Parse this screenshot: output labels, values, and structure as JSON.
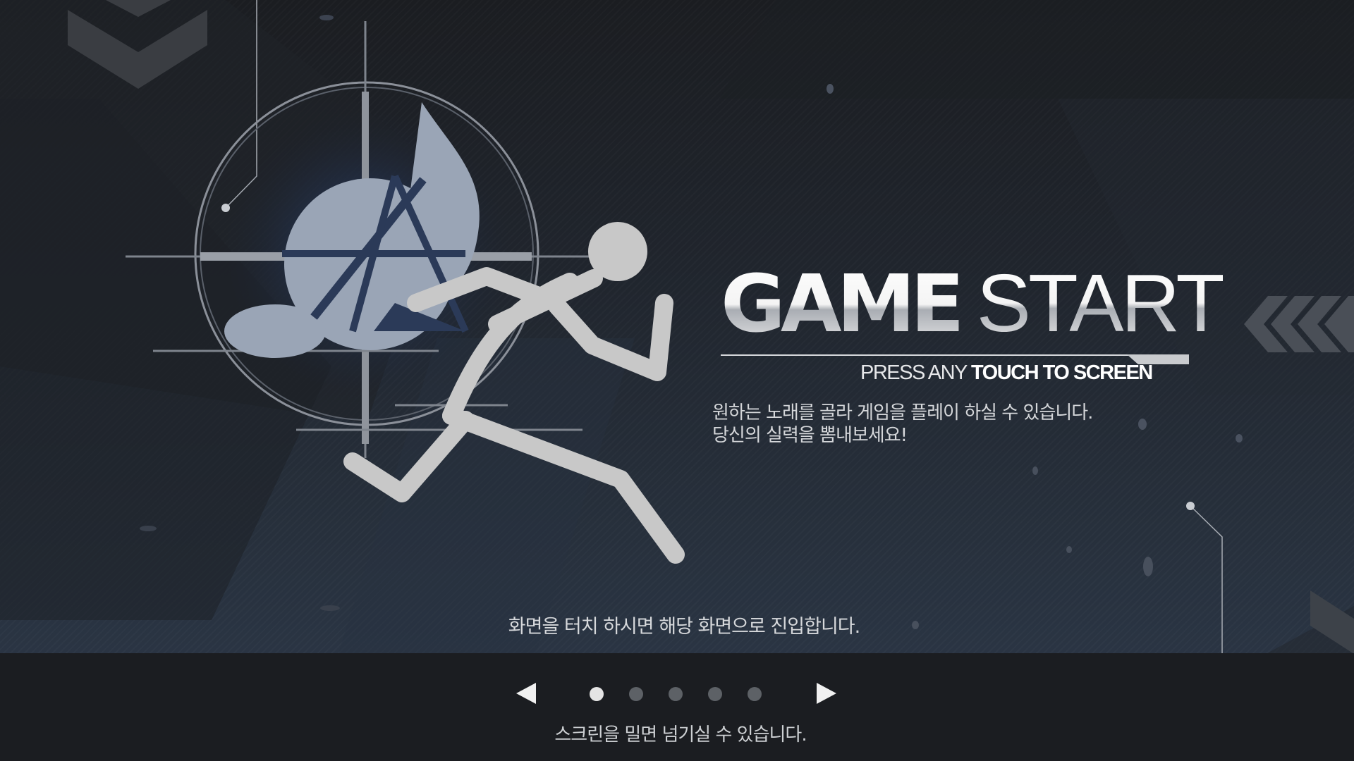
{
  "title": {
    "word1": "GAME",
    "word2": "START"
  },
  "subtitle": {
    "part1": "PRESS ANY",
    "part2": "TOUCH TO SCREEN"
  },
  "description": {
    "line1": "원하는 노래를 골라 게임을 플레이 하실 수 있습니다.",
    "line2": "당신의 실력을 뽐내보세요!"
  },
  "touch_hint": "화면을 터치 하시면 해당 화면으로 진입합니다.",
  "pager": {
    "total_pages": 5,
    "current_page": 1
  },
  "swipe_hint": "스크린을 밀면 넘기실 수 있습니다.",
  "icons": {
    "prev": "left-triangle-arrow-icon",
    "next": "right-triangle-arrow-icon",
    "emblem": "crosshair-music-note-emblem",
    "runner": "running-stick-figure-icon"
  },
  "colors": {
    "background_top": "#1b1d21",
    "background_bottom": "#2b3646",
    "bottom_bar": "#1b1d21",
    "text": "#ffffff",
    "dot_active": "#e4e4e4",
    "dot_inactive": "#5d6166",
    "runner": "#c8c8c8"
  }
}
